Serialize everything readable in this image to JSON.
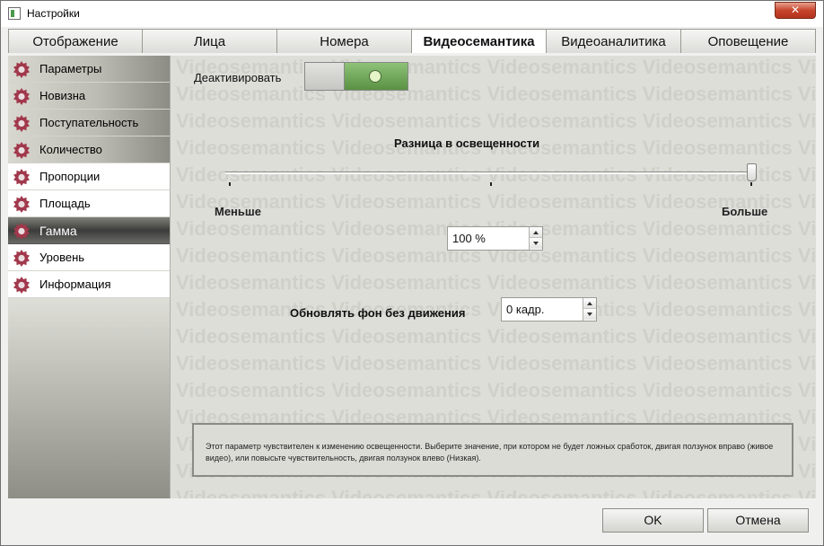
{
  "window": {
    "title": "Настройки",
    "close_glyph": "✕"
  },
  "tabs": [
    {
      "label": "Отображение",
      "active": false
    },
    {
      "label": "Лица",
      "active": false
    },
    {
      "label": "Номера",
      "active": false
    },
    {
      "label": "Видеосемантика",
      "active": true
    },
    {
      "label": "Видеоаналитика",
      "active": false
    },
    {
      "label": "Оповещение",
      "active": false
    }
  ],
  "sidebar": {
    "items": [
      {
        "label": "Параметры",
        "style": "grad"
      },
      {
        "label": "Новизна",
        "style": "grad"
      },
      {
        "label": "Поступательность",
        "style": "grad"
      },
      {
        "label": "Количество",
        "style": "grad"
      },
      {
        "label": "Пропорции",
        "style": "plain"
      },
      {
        "label": "Площадь",
        "style": "plain"
      },
      {
        "label": "Гамма",
        "style": "active"
      },
      {
        "label": "Уровень",
        "style": "plain"
      },
      {
        "label": "Информация",
        "style": "plain"
      }
    ],
    "icon": "gear-icon",
    "icon_color": "#a1384b"
  },
  "content": {
    "watermark_text": "Videosemantics",
    "deactivate_label": "Деактивировать",
    "toggle_on": true,
    "toggle_on_color": "#6ea85a",
    "slider_title": "Разница в освещенности",
    "slider_value_percent": 100,
    "slider_min_label": "Меньше",
    "slider_max_label": "Больше",
    "percent_value": "100 %",
    "refresh_label": "Обновлять фон без движения",
    "frames_value": "0 кадр.",
    "help_text": "Этот параметр чувствителен к изменению освещенности. Выберите значение, при котором не будет ложных сработок, двигая ползунок вправо (живое видео), или повысьте чувствительность, двигая ползунок влево (Низкая)."
  },
  "footer": {
    "ok_label": "OK",
    "cancel_label": "Отмена"
  }
}
